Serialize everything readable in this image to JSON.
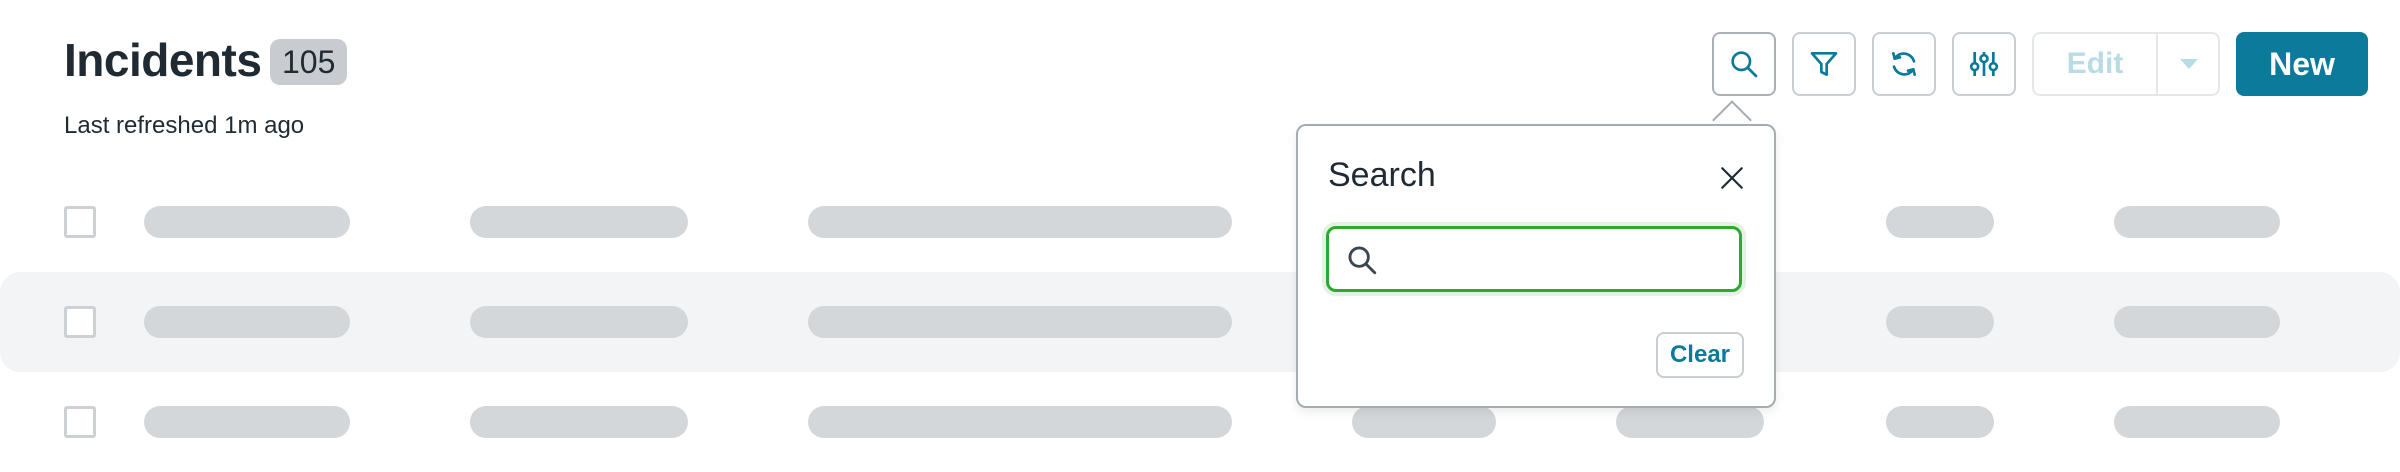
{
  "header": {
    "title": "Incidents",
    "count": "105",
    "last_refreshed": "Last refreshed 1m ago"
  },
  "toolbar": {
    "buttons": [
      {
        "icon": "search-icon"
      },
      {
        "icon": "filter-icon"
      },
      {
        "icon": "refresh-icon"
      },
      {
        "icon": "column-settings-icon"
      }
    ],
    "edit_label": "Edit",
    "edit_enabled": false,
    "new_label": "New"
  },
  "search_popover": {
    "title": "Search",
    "input_value": "",
    "clear_label": "Clear"
  },
  "table": {
    "loading": true,
    "rows_visible": 3
  },
  "colors": {
    "brand": "#0b7a9b",
    "text": "#1f2a33",
    "focus": "#2ea82e",
    "skeleton": "#d3d7da",
    "row_stripe": "#f2f4f5",
    "disabled_text": "#b9dbe6"
  }
}
